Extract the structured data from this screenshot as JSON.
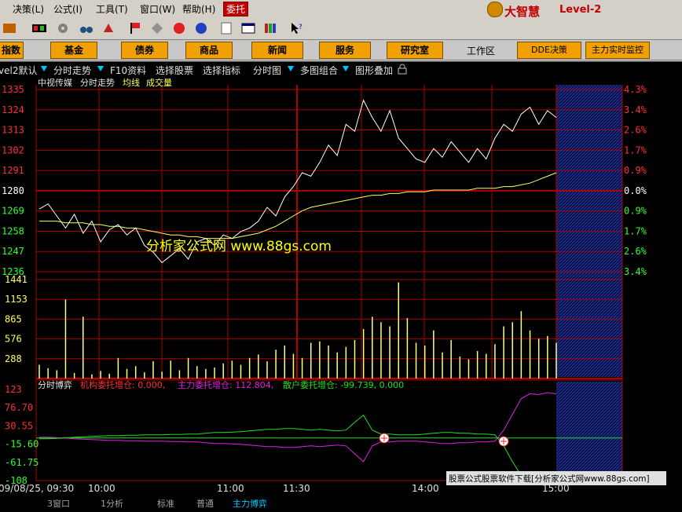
{
  "menu": [
    {
      "label": "决策(L)",
      "active": false
    },
    {
      "label": "公式(I)",
      "active": false
    },
    {
      "label": "工具(T)",
      "active": false
    },
    {
      "label": "窗口(W)",
      "active": false
    },
    {
      "label": "帮助(H)",
      "active": false
    },
    {
      "label": "委托",
      "active": true
    }
  ],
  "brand": {
    "name": "大智慧",
    "edition": "Level-2"
  },
  "nav": [
    "指数",
    "基金",
    "债券",
    "商品",
    "新闻",
    "服务",
    "研究室"
  ],
  "workzone": "工作区",
  "nav_right": [
    "DDE决策",
    "主力实时监控"
  ],
  "tabs": [
    "vel2默认",
    "分时走势",
    "F10资料",
    "选择股票",
    "选择指标",
    "分时图",
    "多图组合",
    "图形叠加"
  ],
  "colors": {
    "background": "#000000",
    "grid": "#b00000",
    "price_line": "#ffffff",
    "avg_line": "#ffff60",
    "volume": "#ffff80",
    "up_text": "#ff3030",
    "down_text": "#30ff30",
    "main_force": "#e020e0",
    "retail": "#20e020",
    "institution": "#ff3030"
  },
  "chart_data": [
    {
      "type": "line",
      "title_items": [
        "中视传媒",
        "分时走势",
        "均线",
        "成交量"
      ],
      "watermark": "分析家公式网 www.88gs.com",
      "y_ticks": [
        "1335",
        "1324",
        "1313",
        "1302",
        "1291",
        "1280",
        "1269",
        "1258",
        "1247",
        "1236"
      ],
      "y_pct_ticks": [
        "4.3%",
        "3.4%",
        "2.6%",
        "1.7%",
        "0.9%",
        "0.0%",
        "0.9%",
        "1.7%",
        "2.6%",
        "3.4%"
      ],
      "ylim": [
        1230,
        1340
      ],
      "prev_close": 1280,
      "series": [
        {
          "name": "分时走势",
          "values": [
            1269,
            1272,
            1265,
            1258,
            1266,
            1255,
            1262,
            1250,
            1257,
            1260,
            1254,
            1258,
            1248,
            1244,
            1238,
            1242,
            1246,
            1240,
            1250,
            1252,
            1248,
            1254,
            1252,
            1256,
            1258,
            1262,
            1270,
            1265,
            1276,
            1282,
            1290,
            1288,
            1296,
            1306,
            1300,
            1318,
            1314,
            1332,
            1322,
            1314,
            1326,
            1310,
            1304,
            1298,
            1296,
            1304,
            1299,
            1308,
            1302,
            1296,
            1304,
            1298,
            1310,
            1318,
            1314,
            1324,
            1328,
            1318,
            1326,
            1322
          ]
        },
        {
          "name": "均线",
          "values": [
            1262,
            1262,
            1262,
            1261,
            1261,
            1261,
            1260,
            1260,
            1259,
            1259,
            1258,
            1258,
            1257,
            1256,
            1255,
            1254,
            1254,
            1253,
            1253,
            1252,
            1252,
            1252,
            1252,
            1253,
            1254,
            1255,
            1257,
            1259,
            1262,
            1265,
            1268,
            1270,
            1271,
            1272,
            1273,
            1274,
            1275,
            1276,
            1277,
            1277,
            1278,
            1278,
            1279,
            1279,
            1279,
            1280,
            1280,
            1280,
            1280,
            1280,
            1281,
            1281,
            1281,
            1282,
            1282,
            1283,
            1284,
            1286,
            1288,
            1290
          ]
        }
      ]
    },
    {
      "type": "bar",
      "title": "成交量",
      "y_ticks": [
        "1441",
        "1153",
        "865",
        "576",
        "288"
      ],
      "ylim": [
        0,
        1441
      ],
      "values": [
        200,
        150,
        120,
        1150,
        80,
        900,
        60,
        110,
        70,
        300,
        140,
        180,
        90,
        250,
        100,
        260,
        120,
        300,
        180,
        140,
        160,
        220,
        260,
        200,
        300,
        350,
        250,
        420,
        480,
        360,
        300,
        520,
        540,
        480,
        380,
        460,
        560,
        720,
        900,
        820,
        760,
        1400,
        880,
        520,
        480,
        700,
        380,
        560,
        320,
        280,
        400,
        360,
        500,
        760,
        820,
        980,
        700,
        580,
        620,
        520
      ]
    },
    {
      "type": "line",
      "title": "分时博弈",
      "legend": [
        {
          "name": "机构委托增仓",
          "value": "0.000"
        },
        {
          "name": "主力委托增仓",
          "value": "112.804"
        },
        {
          "name": "散户委托增仓",
          "value": "-99.739"
        },
        {
          "name": "",
          "value": "0.000"
        }
      ],
      "y_ticks": [
        "123",
        "76.70",
        "30.55",
        "-15.60",
        "-61.75",
        "-108"
      ],
      "ylim": [
        -108,
        123
      ],
      "series": [
        {
          "name": "主力委托增仓",
          "values": [
            2,
            2,
            1,
            0,
            -2,
            -3,
            -4,
            -5,
            -6,
            -6,
            -7,
            -7,
            -8,
            -8,
            -8,
            -9,
            -9,
            -10,
            -10,
            -12,
            -14,
            -14,
            -15,
            -16,
            -18,
            -20,
            -22,
            -22,
            -24,
            -24,
            -22,
            -20,
            -22,
            -20,
            -18,
            -20,
            -40,
            -60,
            -20,
            -10,
            -10,
            -8,
            -8,
            -8,
            -10,
            -12,
            -14,
            -14,
            -12,
            -12,
            -10,
            -10,
            -8,
            20,
            60,
            100,
            112,
            110,
            115,
            112
          ]
        },
        {
          "name": "散户委托增仓",
          "values": [
            -2,
            -2,
            -1,
            0,
            2,
            3,
            4,
            5,
            6,
            6,
            7,
            7,
            8,
            8,
            8,
            9,
            9,
            10,
            10,
            12,
            14,
            14,
            15,
            16,
            18,
            20,
            22,
            22,
            24,
            24,
            22,
            20,
            22,
            20,
            18,
            20,
            40,
            58,
            20,
            10,
            10,
            8,
            8,
            8,
            10,
            12,
            14,
            14,
            12,
            12,
            10,
            10,
            8,
            -20,
            -60,
            -95,
            -100,
            -100,
            -100,
            -99
          ]
        }
      ]
    }
  ],
  "x_ticks": [
    "09/08/25, 09:30",
    "10:00",
    "11:00",
    "11:30",
    "14:00",
    "15:00"
  ],
  "status_tabs": [
    "3窗口",
    "1分析",
    "标准",
    "普通",
    "主力博弈"
  ],
  "bottom_banner": "股票公式股票软件下载[分析家公式网www.88gs.com]"
}
